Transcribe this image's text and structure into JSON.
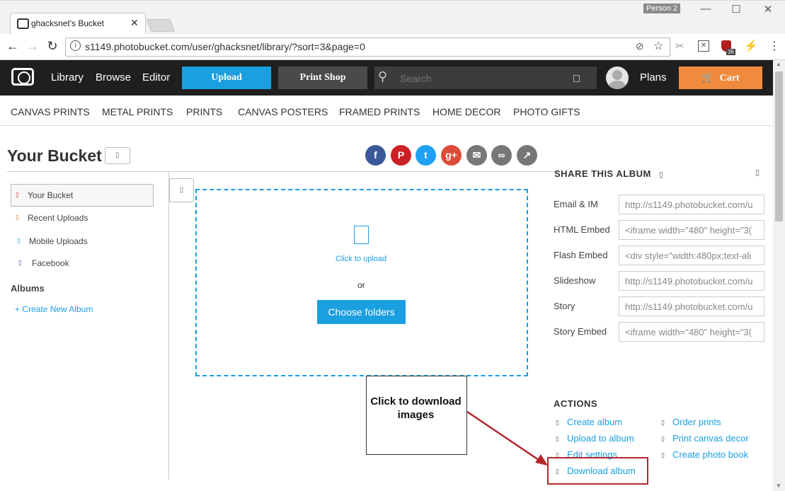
{
  "browser": {
    "tab_title": "ghacksnet's Bucket",
    "tab_close": "✕",
    "profile": "Person 2",
    "url": "s1149.photobucket.com/user/ghacksnet/library/?sort=3&page=0",
    "window_buttons": [
      "—",
      "☐",
      "✕"
    ],
    "ext_badge": "36"
  },
  "site": {
    "nav": [
      "Library",
      "Browse",
      "Editor"
    ],
    "upload_label": "Upload",
    "printshop_label": "Print Shop",
    "search_placeholder": "Search",
    "plans_label": "Plans",
    "cart_label": "Cart"
  },
  "categories": [
    "CANVAS PRINTS",
    "METAL PRINTS",
    "PRINTS",
    "CANVAS POSTERS",
    "FRAMED PRINTS",
    "HOME DECOR",
    "PHOTO GIFTS"
  ],
  "main": {
    "title": "Your Bucket",
    "sidebar": [
      "Your Bucket",
      "Recent Uploads",
      "Mobile Uploads",
      "Facebook"
    ],
    "albums_heading": "Albums",
    "create_album": "+ Create New Album",
    "upload_hint": "Click to upload",
    "or_text": "or",
    "choose_folders": "Choose folders"
  },
  "social": [
    {
      "name": "facebook",
      "glyph": "f",
      "color": "#3b5998"
    },
    {
      "name": "pinterest",
      "glyph": "P",
      "color": "#cb2027"
    },
    {
      "name": "twitter",
      "glyph": "t",
      "color": "#1da1f2"
    },
    {
      "name": "google-plus",
      "glyph": "g+",
      "color": "#dd4b39"
    },
    {
      "name": "email",
      "glyph": "✉",
      "color": "#777777"
    },
    {
      "name": "link",
      "glyph": "∞",
      "color": "#777777"
    },
    {
      "name": "share",
      "glyph": "↗",
      "color": "#777777"
    }
  ],
  "share": {
    "heading": "SHARE THIS ALBUM",
    "rows": [
      {
        "label": "Email & IM",
        "value": "http://s1149.photobucket.com/u"
      },
      {
        "label": "HTML Embed",
        "value": "<iframe width=\"480\" height=\"3("
      },
      {
        "label": "Flash Embed",
        "value": "<div style=\"width:480px;text-ali"
      },
      {
        "label": "Slideshow",
        "value": "http://s1149.photobucket.com/u"
      },
      {
        "label": "Story",
        "value": "http://s1149.photobucket.com/u"
      },
      {
        "label": "Story Embed",
        "value": "<iframe width=\"480\" height=\"3("
      }
    ]
  },
  "actions": {
    "heading": "ACTIONS",
    "left": [
      "Create album",
      "Upload to album",
      "Edit settings",
      "Download album"
    ],
    "right": [
      "Order prints",
      "Print canvas decor",
      "Create photo book"
    ]
  },
  "annotation": {
    "callout": "Click to download images",
    "arrow_color": "#b3262b"
  }
}
